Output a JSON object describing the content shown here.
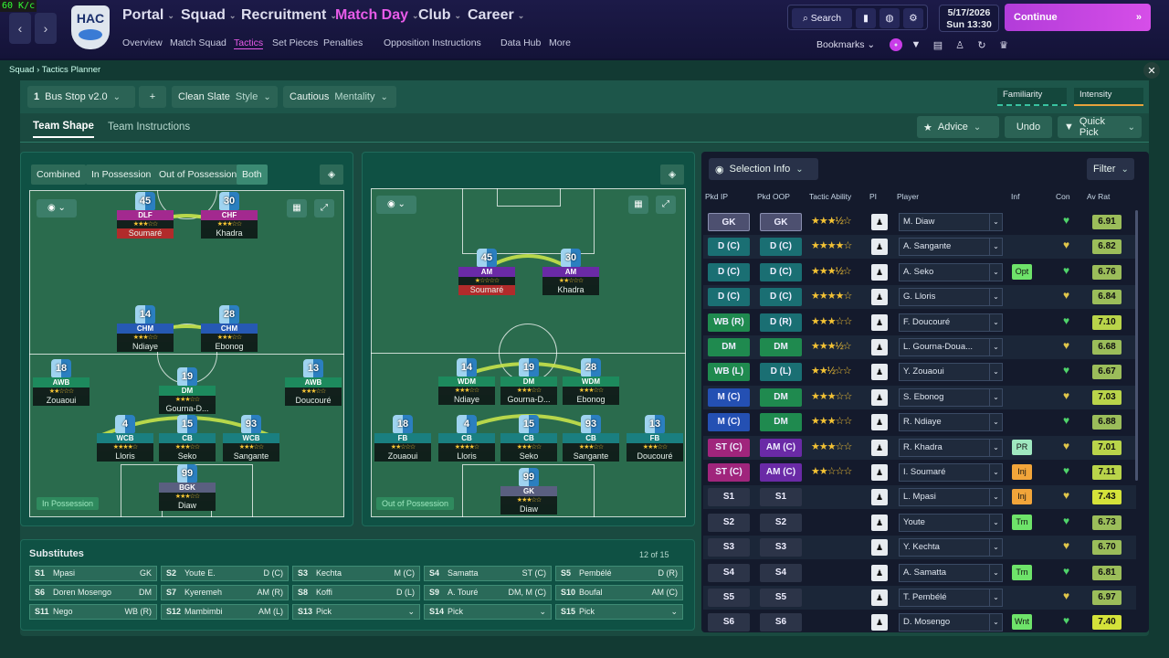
{
  "fps": "60 K/c",
  "club": {
    "crest_text": "HAC"
  },
  "menu": [
    {
      "label": "Portal"
    },
    {
      "label": "Squad"
    },
    {
      "label": "Recruitment"
    },
    {
      "label": "Match Day"
    },
    {
      "label": "Club"
    },
    {
      "label": "Career"
    }
  ],
  "submenu": [
    "Overview",
    "Match Squad",
    "Tactics",
    "Set Pieces",
    "Penalties",
    "Opposition Instructions",
    "Data Hub",
    "More"
  ],
  "topright": {
    "search": "Search",
    "date": "5/17/2026",
    "day": "Sun",
    "time": "13:30",
    "continue": "Continue",
    "bookmarks": "Bookmarks"
  },
  "breadcrumb": {
    "parent": "Squad",
    "current": "Tactics Planner"
  },
  "toolbar": {
    "tactic_num": "1",
    "tactic_name": "Bus Stop v2.0",
    "add": "+",
    "style_value": "Clean Slate",
    "style_label": "Style",
    "mentality_value": "Cautious",
    "mentality_label": "Mentality",
    "familiarity": "Familiarity",
    "intensity": "Intensity"
  },
  "tabs": {
    "shape": "Team Shape",
    "instructions": "Team Instructions",
    "advice": "Advice",
    "undo": "Undo",
    "quick_pick": "Quick Pick"
  },
  "phase": {
    "combined": "Combined",
    "in_possession": "In Possession",
    "out_possession": "Out of Possession",
    "both": "Both"
  },
  "pitch_labels": {
    "left": "In Possession",
    "right": "Out of Possession"
  },
  "selection": {
    "info": "Selection Info",
    "filter": "Filter"
  },
  "headers": {
    "ip": "Pkd IP",
    "oop": "Pkd OOP",
    "ability": "Tactic Ability",
    "pi": "PI",
    "player": "Player",
    "inf": "Inf",
    "con": "Con",
    "avr": "Av Rat"
  },
  "accent": "#e75be8",
  "rows": [
    {
      "ip": "GK",
      "oop": "GK",
      "stars": "★★★½☆",
      "player": "M. Diaw",
      "inf": "",
      "avr": "6.91"
    },
    {
      "ip": "D (C)",
      "oop": "D (C)",
      "stars": "★★★★☆",
      "player": "A. Sangante",
      "inf": "",
      "avr": "6.82"
    },
    {
      "ip": "D (C)",
      "oop": "D (C)",
      "stars": "★★★½☆",
      "player": "A. Seko",
      "inf": "Opt",
      "avr": "6.76"
    },
    {
      "ip": "D (C)",
      "oop": "D (C)",
      "stars": "★★★★☆",
      "player": "G. Lloris",
      "inf": "",
      "avr": "6.84"
    },
    {
      "ip": "WB (R)",
      "oop": "D (R)",
      "stars": "★★★☆☆",
      "player": "F. Doucouré",
      "inf": "",
      "avr": "7.10"
    },
    {
      "ip": "DM",
      "oop": "DM",
      "stars": "★★★½☆",
      "player": "L. Gourna-Doua...",
      "inf": "",
      "avr": "6.68"
    },
    {
      "ip": "WB (L)",
      "oop": "D (L)",
      "stars": "★★½☆☆",
      "player": "Y. Zouaoui",
      "inf": "",
      "avr": "6.67"
    },
    {
      "ip": "M (C)",
      "oop": "DM",
      "stars": "★★★☆☆",
      "player": "S. Ebonog",
      "inf": "",
      "avr": "7.03"
    },
    {
      "ip": "M (C)",
      "oop": "DM",
      "stars": "★★★☆☆",
      "player": "R. Ndiaye",
      "inf": "",
      "avr": "6.88"
    },
    {
      "ip": "ST (C)",
      "oop": "AM (C)",
      "stars": "★★★☆☆",
      "player": "R. Khadra",
      "inf": "PR",
      "avr": "7.01"
    },
    {
      "ip": "ST (C)",
      "oop": "AM (C)",
      "stars": "★★☆☆☆",
      "player": "I. Soumaré",
      "inf": "Inj",
      "avr": "7.11"
    },
    {
      "ip": "S1",
      "oop": "S1",
      "stars": "",
      "player": "L. Mpasi",
      "inf": "Inj",
      "avr": "7.43"
    },
    {
      "ip": "S2",
      "oop": "S2",
      "stars": "",
      "player": "Youte",
      "inf": "Trn",
      "avr": "6.73"
    },
    {
      "ip": "S3",
      "oop": "S3",
      "stars": "",
      "player": "Y. Kechta",
      "inf": "",
      "avr": "6.70"
    },
    {
      "ip": "S4",
      "oop": "S4",
      "stars": "",
      "player": "A. Samatta",
      "inf": "Trn",
      "avr": "6.81"
    },
    {
      "ip": "S5",
      "oop": "S5",
      "stars": "",
      "player": "T. Pembélé",
      "inf": "",
      "avr": "6.97"
    },
    {
      "ip": "S6",
      "oop": "S6",
      "stars": "",
      "player": "D. Mosengo",
      "inf": "Wnt",
      "avr": "7.40"
    }
  ],
  "subs": {
    "title": "Substitutes",
    "count": "12 of 15",
    "cells": [
      {
        "slot": "S1",
        "name": "Mpasi",
        "pos": "GK"
      },
      {
        "slot": "S2",
        "name": "Youte E.",
        "pos": "D (C)"
      },
      {
        "slot": "S3",
        "name": "Kechta",
        "pos": "M (C)"
      },
      {
        "slot": "S4",
        "name": "Samatta",
        "pos": "ST (C)"
      },
      {
        "slot": "S5",
        "name": "Pembélé",
        "pos": "D (R)"
      },
      {
        "slot": "S6",
        "name": "Doren Mosengo",
        "pos": "DM"
      },
      {
        "slot": "S7",
        "name": "Kyeremeh",
        "pos": "AM (R)"
      },
      {
        "slot": "S8",
        "name": "Koffi",
        "pos": "D (L)"
      },
      {
        "slot": "S9",
        "name": "A. Touré",
        "pos": "DM, M (C)"
      },
      {
        "slot": "S10",
        "name": "Boufal",
        "pos": "AM (C)"
      },
      {
        "slot": "S11",
        "name": "Nego",
        "pos": "WB (R)"
      },
      {
        "slot": "S12",
        "name": "Mambimbi",
        "pos": "AM (L)"
      },
      {
        "slot": "S13",
        "name": "Pick",
        "pos": "⌄"
      },
      {
        "slot": "S14",
        "name": "Pick",
        "pos": "⌄"
      },
      {
        "slot": "S15",
        "name": "Pick",
        "pos": "⌄"
      }
    ]
  },
  "ip_players": [
    {
      "num": "45",
      "role": "DLF",
      "stars": "★★★☆☆",
      "name": "Soumaré",
      "color": "mag",
      "red": true
    },
    {
      "num": "30",
      "role": "CHF",
      "stars": "★★★☆☆",
      "name": "Khadra",
      "color": "mag",
      "red": false
    },
    {
      "num": "14",
      "role": "CHM",
      "stars": "★★★☆☆",
      "name": "Ndiaye",
      "color": "blue",
      "red": false
    },
    {
      "num": "28",
      "role": "CHM",
      "stars": "★★★☆☆",
      "name": "Ebonog",
      "color": "blue",
      "red": false
    },
    {
      "num": "18",
      "role": "AWB",
      "stars": "★★☆☆☆",
      "name": "Zouaoui",
      "color": "green",
      "red": false
    },
    {
      "num": "19",
      "role": "DM",
      "stars": "★★★☆☆",
      "name": "Gourna-D...",
      "color": "green",
      "red": false
    },
    {
      "num": "13",
      "role": "AWB",
      "stars": "★★★☆☆",
      "name": "Doucouré",
      "color": "green",
      "red": false
    },
    {
      "num": "4",
      "role": "WCB",
      "stars": "★★★★☆",
      "name": "Lloris",
      "color": "teal",
      "red": false
    },
    {
      "num": "15",
      "role": "CB",
      "stars": "★★★☆☆",
      "name": "Seko",
      "color": "teal",
      "red": false
    },
    {
      "num": "93",
      "role": "WCB",
      "stars": "★★★☆☆",
      "name": "Sangante",
      "color": "teal",
      "red": false
    },
    {
      "num": "99",
      "role": "BGK",
      "stars": "★★★☆☆",
      "name": "Diaw",
      "color": "gk",
      "red": false
    }
  ],
  "oop_players": [
    {
      "num": "45",
      "role": "AM",
      "stars": "★☆☆☆☆",
      "name": "Soumaré",
      "color": "purple",
      "red": true
    },
    {
      "num": "30",
      "role": "AM",
      "stars": "★★☆☆☆",
      "name": "Khadra",
      "color": "purple",
      "red": false
    },
    {
      "num": "14",
      "role": "WDM",
      "stars": "★★★☆☆",
      "name": "Ndiaye",
      "color": "green",
      "red": false
    },
    {
      "num": "19",
      "role": "DM",
      "stars": "★★★☆☆",
      "name": "Gourna-D...",
      "color": "green",
      "red": false
    },
    {
      "num": "28",
      "role": "WDM",
      "stars": "★★★☆☆",
      "name": "Ebonog",
      "color": "green",
      "red": false
    },
    {
      "num": "18",
      "role": "FB",
      "stars": "★★☆☆☆",
      "name": "Zouaoui",
      "color": "teal",
      "red": false
    },
    {
      "num": "4",
      "role": "CB",
      "stars": "★★★★☆",
      "name": "Lloris",
      "color": "teal",
      "red": false
    },
    {
      "num": "15",
      "role": "CB",
      "stars": "★★★☆☆",
      "name": "Seko",
      "color": "teal",
      "red": false
    },
    {
      "num": "93",
      "role": "CB",
      "stars": "★★★☆☆",
      "name": "Sangante",
      "color": "teal",
      "red": false
    },
    {
      "num": "13",
      "role": "FB",
      "stars": "★★★☆☆",
      "name": "Doucouré",
      "color": "teal",
      "red": false
    },
    {
      "num": "99",
      "role": "GK",
      "stars": "★★★☆☆",
      "name": "Diaw",
      "color": "gk",
      "red": false
    }
  ]
}
